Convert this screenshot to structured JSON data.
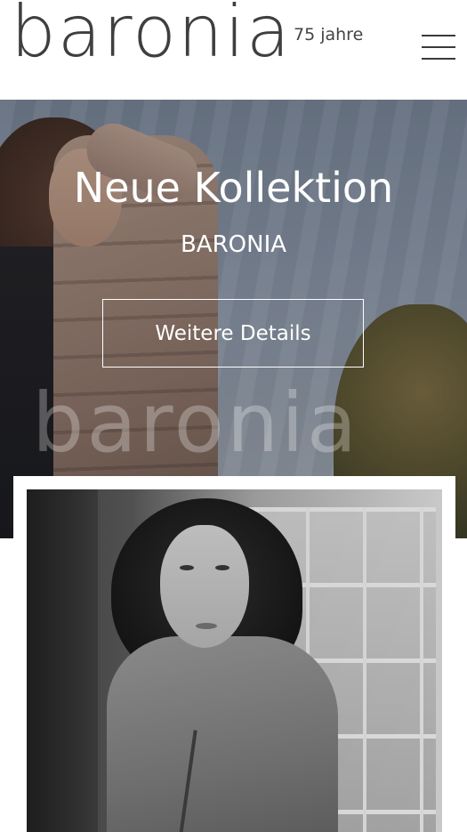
{
  "header": {
    "logo_text": "baronia",
    "tagline": "75 jahre",
    "menu_icon": "hamburger-menu-icon"
  },
  "hero": {
    "title": "Neue Kollektion",
    "subtitle": "BARONIA",
    "button_label": "Weitere Details",
    "watermark": "baronia"
  },
  "colors": {
    "logo": "#3f3f3f",
    "hero_text": "#ffffff",
    "background": "#ffffff"
  }
}
